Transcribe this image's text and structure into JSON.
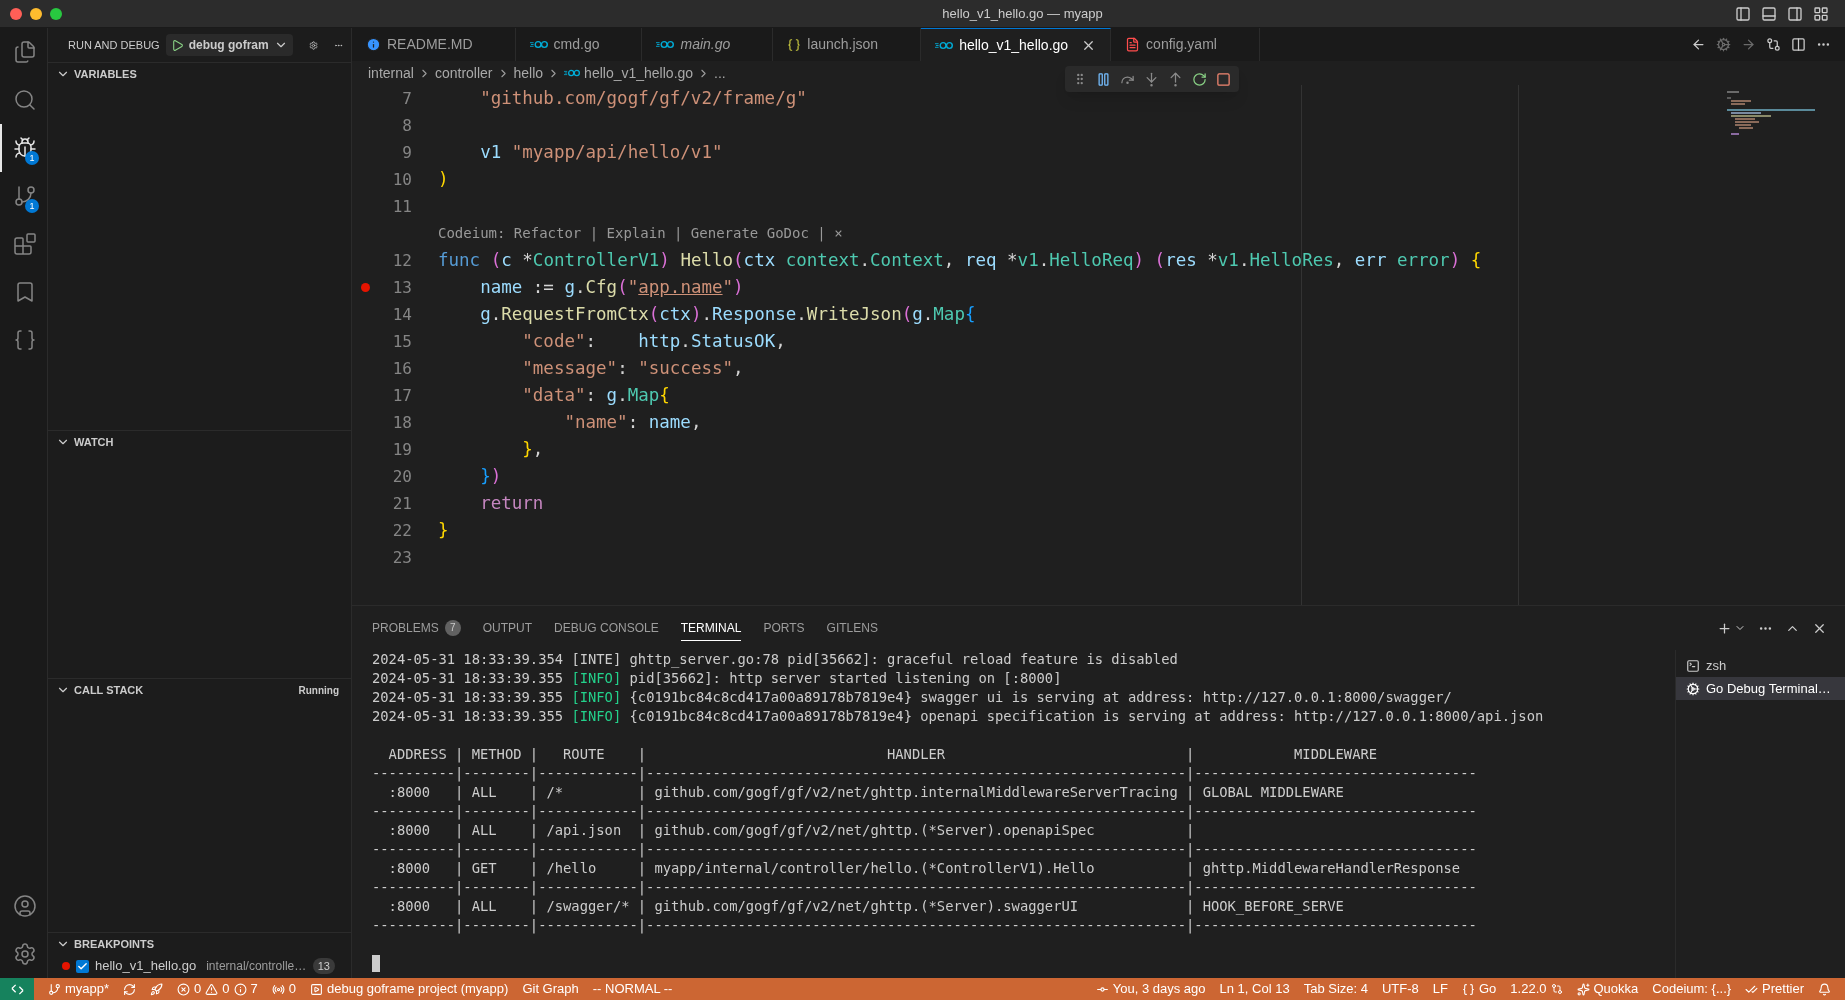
{
  "window": {
    "title": "hello_v1_hello.go — myapp"
  },
  "activity_bar": {
    "items": [
      {
        "kind": "files",
        "selected": false
      },
      {
        "kind": "search",
        "selected": false
      },
      {
        "kind": "debug",
        "selected": true,
        "badge": "1"
      },
      {
        "kind": "source-control",
        "selected": false,
        "badge": "1"
      },
      {
        "kind": "extensions",
        "selected": false
      },
      {
        "kind": "bookmark",
        "selected": false
      },
      {
        "kind": "braces",
        "selected": false
      }
    ],
    "bottom": [
      {
        "kind": "account"
      },
      {
        "kind": "settings"
      }
    ]
  },
  "sidebar": {
    "title": "RUN AND DEBUG",
    "config": "debug gofram",
    "sections": [
      {
        "title": "VARIABLES",
        "expanded": true
      },
      {
        "title": "WATCH",
        "expanded": true
      },
      {
        "title": "CALL STACK",
        "expanded": true,
        "status": "Running"
      },
      {
        "title": "BREAKPOINTS",
        "expanded": true
      }
    ],
    "breakpoints": [
      {
        "file": "hello_v1_hello.go",
        "path": "internal/controlle…",
        "line": "13",
        "checked": true
      }
    ]
  },
  "tabs": [
    {
      "label": "README.MD",
      "kind": "info",
      "selected": false,
      "italic": false
    },
    {
      "label": "cmd.go",
      "kind": "go",
      "selected": false,
      "italic": false
    },
    {
      "label": "main.go",
      "kind": "go",
      "selected": false,
      "italic": true
    },
    {
      "label": "launch.json",
      "kind": "json",
      "selected": false,
      "italic": false
    },
    {
      "label": "hello_v1_hello.go",
      "kind": "go",
      "selected": true,
      "italic": false
    },
    {
      "label": "config.yaml",
      "kind": "yaml",
      "selected": false,
      "italic": false
    }
  ],
  "breadcrumbs": [
    {
      "label": "internal",
      "kind": "folder"
    },
    {
      "label": "controller",
      "kind": "folder"
    },
    {
      "label": "hello",
      "kind": "folder"
    },
    {
      "label": "hello_v1_hello.go",
      "kind": "go"
    },
    {
      "label": "...",
      "kind": "symbol"
    }
  ],
  "editor": {
    "lines": [
      {
        "kind": "code",
        "number": "7",
        "breakpoint": false,
        "tokens": [
          {
            "text": "    \"github.com/gogf/gf/v2/frame/g\"",
            "kind": "str"
          }
        ]
      },
      {
        "kind": "code",
        "number": "8",
        "breakpoint": false
      },
      {
        "kind": "code",
        "number": "9",
        "breakpoint": false,
        "tokens": [
          {
            "text": "    v1",
            "kind": "var"
          },
          {
            "text": " \"myapp/api/hello/v1\"",
            "kind": "str"
          }
        ]
      },
      {
        "kind": "code",
        "number": "10",
        "breakpoint": false,
        "tokens": [
          {
            "text": ")",
            "kind": "b1"
          }
        ]
      },
      {
        "kind": "code",
        "number": "11",
        "breakpoint": false
      },
      {
        "kind": "codelens",
        "text": "Codeium: Refactor | Explain | Generate GoDoc | ×"
      },
      {
        "kind": "code",
        "number": "12",
        "breakpoint": false,
        "tokens": [
          {
            "text": "func",
            "kind": "kw"
          },
          {
            "text": " (",
            "kind": "b2"
          },
          {
            "text": "c",
            "kind": "var"
          },
          {
            "text": " *",
            "kind": "plain"
          },
          {
            "text": "ControllerV1",
            "kind": "type"
          },
          {
            "text": ")",
            "kind": "b2"
          },
          {
            "text": " Hello",
            "kind": "fn"
          },
          {
            "text": "(",
            "kind": "b2"
          },
          {
            "text": "ctx",
            "kind": "var"
          },
          {
            "text": " context",
            "kind": "type"
          },
          {
            "text": ".",
            "kind": "plain"
          },
          {
            "text": "Context",
            "kind": "type"
          },
          {
            "text": ", ",
            "kind": "plain"
          },
          {
            "text": "req",
            "kind": "var"
          },
          {
            "text": " *",
            "kind": "plain"
          },
          {
            "text": "v1",
            "kind": "type"
          },
          {
            "text": ".",
            "kind": "plain"
          },
          {
            "text": "HelloReq",
            "kind": "type"
          },
          {
            "text": ")",
            "kind": "b2"
          },
          {
            "text": " (",
            "kind": "b2"
          },
          {
            "text": "res",
            "kind": "var"
          },
          {
            "text": " *",
            "kind": "plain"
          },
          {
            "text": "v1",
            "kind": "type"
          },
          {
            "text": ".",
            "kind": "plain"
          },
          {
            "text": "HelloRes",
            "kind": "type"
          },
          {
            "text": ", ",
            "kind": "plain"
          },
          {
            "text": "err",
            "kind": "var"
          },
          {
            "text": " error",
            "kind": "type"
          },
          {
            "text": ")",
            "kind": "b2"
          },
          {
            "text": " {",
            "kind": "b1"
          }
        ]
      },
      {
        "kind": "code",
        "number": "13",
        "breakpoint": true,
        "tokens": [
          {
            "text": "    name",
            "kind": "var"
          },
          {
            "text": " := ",
            "kind": "plain"
          },
          {
            "text": "g",
            "kind": "var"
          },
          {
            "text": ".",
            "kind": "plain"
          },
          {
            "text": "Cfg",
            "kind": "fn"
          },
          {
            "text": "(",
            "kind": "b2"
          },
          {
            "text": "\"",
            "kind": "str"
          },
          {
            "text": "app.name",
            "kind": "strlink"
          },
          {
            "text": "\"",
            "kind": "str"
          },
          {
            "text": ")",
            "kind": "b2"
          }
        ]
      },
      {
        "kind": "code",
        "number": "14",
        "breakpoint": false,
        "tokens": [
          {
            "text": "    g",
            "kind": "var"
          },
          {
            "text": ".",
            "kind": "plain"
          },
          {
            "text": "RequestFromCtx",
            "kind": "fn"
          },
          {
            "text": "(",
            "kind": "b2"
          },
          {
            "text": "ctx",
            "kind": "var"
          },
          {
            "text": ")",
            "kind": "b2"
          },
          {
            "text": ".",
            "kind": "plain"
          },
          {
            "text": "Response",
            "kind": "var"
          },
          {
            "text": ".",
            "kind": "plain"
          },
          {
            "text": "WriteJson",
            "kind": "fn"
          },
          {
            "text": "(",
            "kind": "b2"
          },
          {
            "text": "g",
            "kind": "var"
          },
          {
            "text": ".",
            "kind": "plain"
          },
          {
            "text": "Map",
            "kind": "type"
          },
          {
            "text": "{",
            "kind": "b3"
          }
        ]
      },
      {
        "kind": "code",
        "number": "15",
        "breakpoint": false,
        "tokens": [
          {
            "text": "        \"code\"",
            "kind": "str"
          },
          {
            "text": ":",
            "kind": "plain"
          },
          {
            "text": "    http",
            "kind": "var"
          },
          {
            "text": ".",
            "kind": "plain"
          },
          {
            "text": "StatusOK",
            "kind": "var"
          },
          {
            "text": ",",
            "kind": "plain"
          }
        ]
      },
      {
        "kind": "code",
        "number": "16",
        "breakpoint": false,
        "tokens": [
          {
            "text": "        \"message\"",
            "kind": "str"
          },
          {
            "text": ":",
            "kind": "plain"
          },
          {
            "text": " \"success\"",
            "kind": "str"
          },
          {
            "text": ",",
            "kind": "plain"
          }
        ]
      },
      {
        "kind": "code",
        "number": "17",
        "breakpoint": false,
        "tokens": [
          {
            "text": "        \"data\"",
            "kind": "str"
          },
          {
            "text": ":",
            "kind": "plain"
          },
          {
            "text": " g",
            "kind": "var"
          },
          {
            "text": ".",
            "kind": "plain"
          },
          {
            "text": "Map",
            "kind": "type"
          },
          {
            "text": "{",
            "kind": "b1"
          }
        ]
      },
      {
        "kind": "code",
        "number": "18",
        "breakpoint": false,
        "tokens": [
          {
            "text": "            \"name\"",
            "kind": "str"
          },
          {
            "text": ":",
            "kind": "plain"
          },
          {
            "text": " name",
            "kind": "var"
          },
          {
            "text": ",",
            "kind": "plain"
          }
        ]
      },
      {
        "kind": "code",
        "number": "19",
        "breakpoint": false,
        "tokens": [
          {
            "text": "        }",
            "kind": "b1"
          },
          {
            "text": ",",
            "kind": "plain"
          }
        ]
      },
      {
        "kind": "code",
        "number": "20",
        "breakpoint": false,
        "tokens": [
          {
            "text": "    }",
            "kind": "b3"
          },
          {
            "text": ")",
            "kind": "b2"
          }
        ]
      },
      {
        "kind": "code",
        "number": "21",
        "breakpoint": false,
        "tokens": [
          {
            "text": "    return",
            "kind": "ctrl"
          }
        ]
      },
      {
        "kind": "code",
        "number": "22",
        "breakpoint": false,
        "tokens": [
          {
            "text": "}",
            "kind": "b1"
          }
        ]
      },
      {
        "kind": "code",
        "number": "23",
        "breakpoint": false
      }
    ]
  },
  "panel": {
    "tabs": [
      {
        "label": "PROBLEMS",
        "badge": "7",
        "selected": false
      },
      {
        "label": "OUTPUT",
        "selected": false
      },
      {
        "label": "DEBUG CONSOLE",
        "selected": false
      },
      {
        "label": "TERMINAL",
        "selected": true
      },
      {
        "label": "PORTS",
        "selected": false
      },
      {
        "label": "GITLENS",
        "selected": false
      }
    ],
    "terminal": {
      "log_lines": [
        {
          "time": "2024-05-31 18:33:39.354",
          "level": "[INTE]",
          "kind": "plain",
          "message": "ghttp_server.go:78 pid[35662]: graceful reload feature is disabled"
        },
        {
          "time": "2024-05-31 18:33:39.355",
          "level": "[INFO]",
          "kind": "info",
          "message": "pid[35662]: http server started listening on [:8000]"
        },
        {
          "time": "2024-05-31 18:33:39.355",
          "level": "[INFO]",
          "kind": "info",
          "message": "{c0191bc84c8cd417a00a89178b7819e4} swagger ui is serving at address: http://127.0.0.1:8000/swagger/"
        },
        {
          "time": "2024-05-31 18:33:39.355",
          "level": "[INFO]",
          "kind": "info",
          "message": "{c0191bc84c8cd417a00a89178b7819e4} openapi specification is serving at address: http://127.0.0.1:8000/api.json"
        }
      ],
      "table_lines": [
        "  ADDRESS | METHOD |   ROUTE    |                             HANDLER                             |            MIDDLEWARE",
        "----------|--------|------------|-----------------------------------------------------------------|----------------------------------",
        "  :8000   | ALL    | /*         | github.com/gogf/gf/v2/net/ghttp.internalMiddlewareServerTracing | GLOBAL MIDDLEWARE",
        "----------|--------|------------|-----------------------------------------------------------------|----------------------------------",
        "  :8000   | ALL    | /api.json  | github.com/gogf/gf/v2/net/ghttp.(*Server).openapiSpec           |",
        "----------|--------|------------|-----------------------------------------------------------------|----------------------------------",
        "  :8000   | GET    | /hello     | myapp/internal/controller/hello.(*ControllerV1).Hello           | ghttp.MiddlewareHandlerResponse",
        "----------|--------|------------|-----------------------------------------------------------------|----------------------------------",
        "  :8000   | ALL    | /swagger/* | github.com/gogf/gf/v2/net/ghttp.(*Server).swaggerUI             | HOOK_BEFORE_SERVE",
        "----------|--------|------------|-----------------------------------------------------------------|----------------------------------"
      ],
      "cursor": true
    },
    "terminals": [
      {
        "label": "zsh",
        "kind": "shell",
        "selected": false
      },
      {
        "label": "Go Debug Terminal…",
        "kind": "task",
        "selected": true
      }
    ]
  },
  "status_bar": {
    "left": [
      {
        "kind": "remote"
      },
      {
        "kind": "branch",
        "text": "myapp*"
      },
      {
        "kind": "sync"
      },
      {
        "kind": "rocket"
      },
      {
        "kind": "problems",
        "errors": "0",
        "warnings": "0",
        "infos": "7"
      },
      {
        "kind": "ports",
        "text": "0"
      },
      {
        "kind": "debug",
        "text": "debug goframe project (myapp)"
      },
      {
        "kind": "plain",
        "text": "Git Graph"
      },
      {
        "kind": "plain",
        "text": "-- NORMAL --"
      }
    ],
    "right": [
      {
        "kind": "blame",
        "text": "You, 3 days ago"
      },
      {
        "kind": "plain",
        "text": "Ln 1, Col 13"
      },
      {
        "kind": "plain",
        "text": "Tab Size: 4"
      },
      {
        "kind": "plain",
        "text": "UTF-8"
      },
      {
        "kind": "plain",
        "text": "LF"
      },
      {
        "kind": "language",
        "text": "Go"
      },
      {
        "kind": "version",
        "text": "1.22.0"
      },
      {
        "kind": "quokka",
        "text": "Quokka"
      },
      {
        "kind": "plain",
        "text": "Codeium: {...}"
      },
      {
        "kind": "prettier",
        "text": "Prettier"
      },
      {
        "kind": "bell"
      }
    ]
  }
}
